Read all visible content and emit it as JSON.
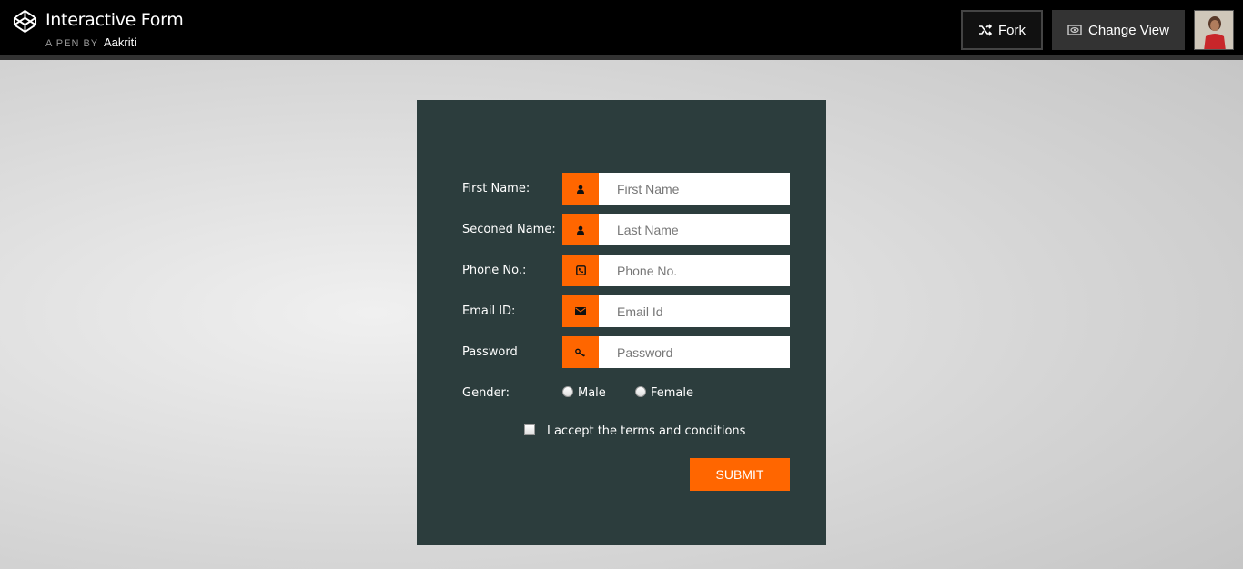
{
  "header": {
    "title": "Interactive Form",
    "byline_prefix": "A PEN BY",
    "author": "Aakriti",
    "fork_label": "Fork",
    "change_view_label": "Change View",
    "logo_icon": "codepen-logo-icon",
    "fork_icon": "fork-icon",
    "change_view_icon": "eye-icon"
  },
  "form": {
    "fields": [
      {
        "label": "First Name:",
        "placeholder": "First Name",
        "icon": "user-icon"
      },
      {
        "label": "Seconed Name:",
        "placeholder": "Last Name",
        "icon": "user-icon"
      },
      {
        "label": "Phone No.:",
        "placeholder": "Phone No.",
        "icon": "phone-icon"
      },
      {
        "label": "Email ID:",
        "placeholder": "Email Id",
        "icon": "envelope-icon"
      },
      {
        "label": "Password",
        "placeholder": "Password",
        "icon": "key-icon"
      }
    ],
    "gender": {
      "label": "Gender:",
      "options": [
        "Male",
        "Female"
      ]
    },
    "terms_label": "I accept the terms and conditions",
    "submit_label": "SUBMIT"
  },
  "colors": {
    "accent": "#ff6600",
    "card_bg": "#2c3d3d",
    "header_bg": "#000000"
  }
}
